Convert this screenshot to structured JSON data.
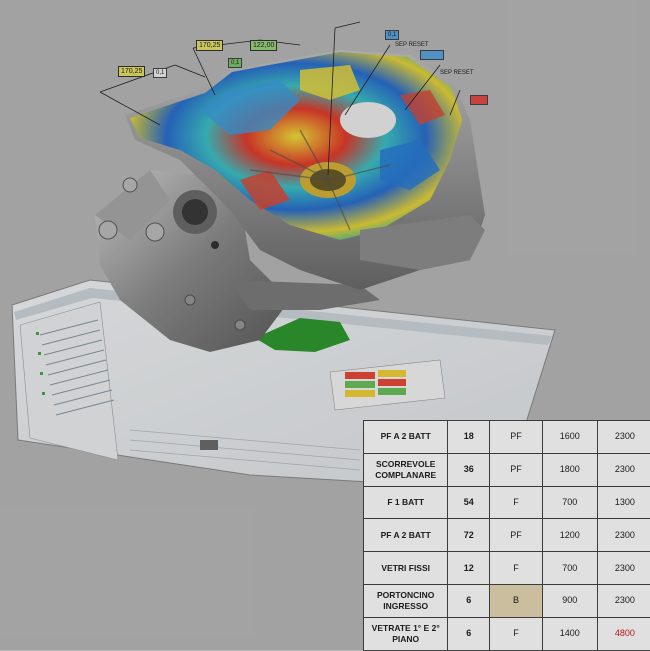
{
  "annotations": {
    "dim_1": "170,25",
    "dim_2": "170,25",
    "dim_3": "122,00",
    "box_a": "0,1",
    "box_b": "0,1",
    "box_c": "0,1",
    "sep_1": "SEP RESET",
    "sep_2": "SEP RESET"
  },
  "table": {
    "rows": [
      {
        "type": "PF A 2 BATT",
        "qty": "18",
        "code": "PF",
        "w": "1600",
        "h": "2300",
        "highlight_code": false,
        "alert_h": false
      },
      {
        "type": "SCORREVOLE COMPLANARE",
        "qty": "36",
        "code": "PF",
        "w": "1800",
        "h": "2300",
        "highlight_code": false,
        "alert_h": false
      },
      {
        "type": "F 1 BATT",
        "qty": "54",
        "code": "F",
        "w": "700",
        "h": "1300",
        "highlight_code": false,
        "alert_h": false
      },
      {
        "type": "PF A 2 BATT",
        "qty": "72",
        "code": "PF",
        "w": "1200",
        "h": "2300",
        "highlight_code": false,
        "alert_h": false
      },
      {
        "type": "VETRI FISSI",
        "qty": "12",
        "code": "F",
        "w": "700",
        "h": "2300",
        "highlight_code": false,
        "alert_h": false
      },
      {
        "type": "PORTONCINO INGRESSO",
        "qty": "6",
        "code": "B",
        "w": "900",
        "h": "2300",
        "highlight_code": true,
        "alert_h": false
      },
      {
        "type": "VETRATE 1° E 2° PIANO",
        "qty": "6",
        "code": "F",
        "w": "1400",
        "h": "4800",
        "highlight_code": false,
        "alert_h": true
      }
    ]
  },
  "colors": {
    "background": "#b9b9b9",
    "table_highlight": "#e8d9b4",
    "alert_red": "#d11b1b",
    "dim_yellow": "#e9e36a"
  },
  "icons": [
    "cad-part-image",
    "software-window-image"
  ]
}
